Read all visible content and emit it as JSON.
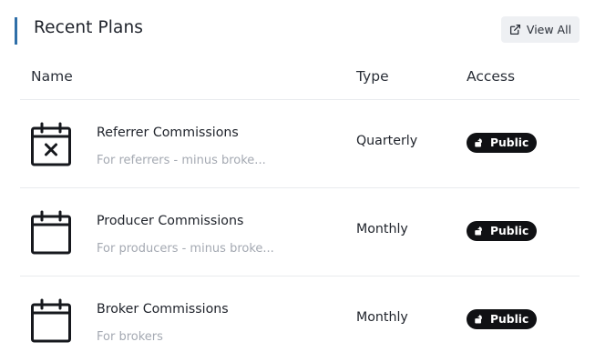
{
  "header": {
    "title": "Recent Plans",
    "view_all_label": "View All",
    "view_all_icon": "external-link-icon",
    "accent_color": "#2f6fa8"
  },
  "columns": {
    "name": "Name",
    "type": "Type",
    "access": "Access"
  },
  "plans": [
    {
      "name": "Referrer Commissions",
      "description": "For referrers - minus broke...",
      "type": "Quarterly",
      "access": "Public",
      "icon": "calendar-x-icon"
    },
    {
      "name": "Producer Commissions",
      "description": "For producers - minus broke...",
      "type": "Monthly",
      "access": "Public",
      "icon": "calendar-icon"
    },
    {
      "name": "Broker Commissions",
      "description": "For brokers",
      "type": "Monthly",
      "access": "Public",
      "icon": "calendar-icon"
    }
  ],
  "badge_icon": "unlock-icon"
}
